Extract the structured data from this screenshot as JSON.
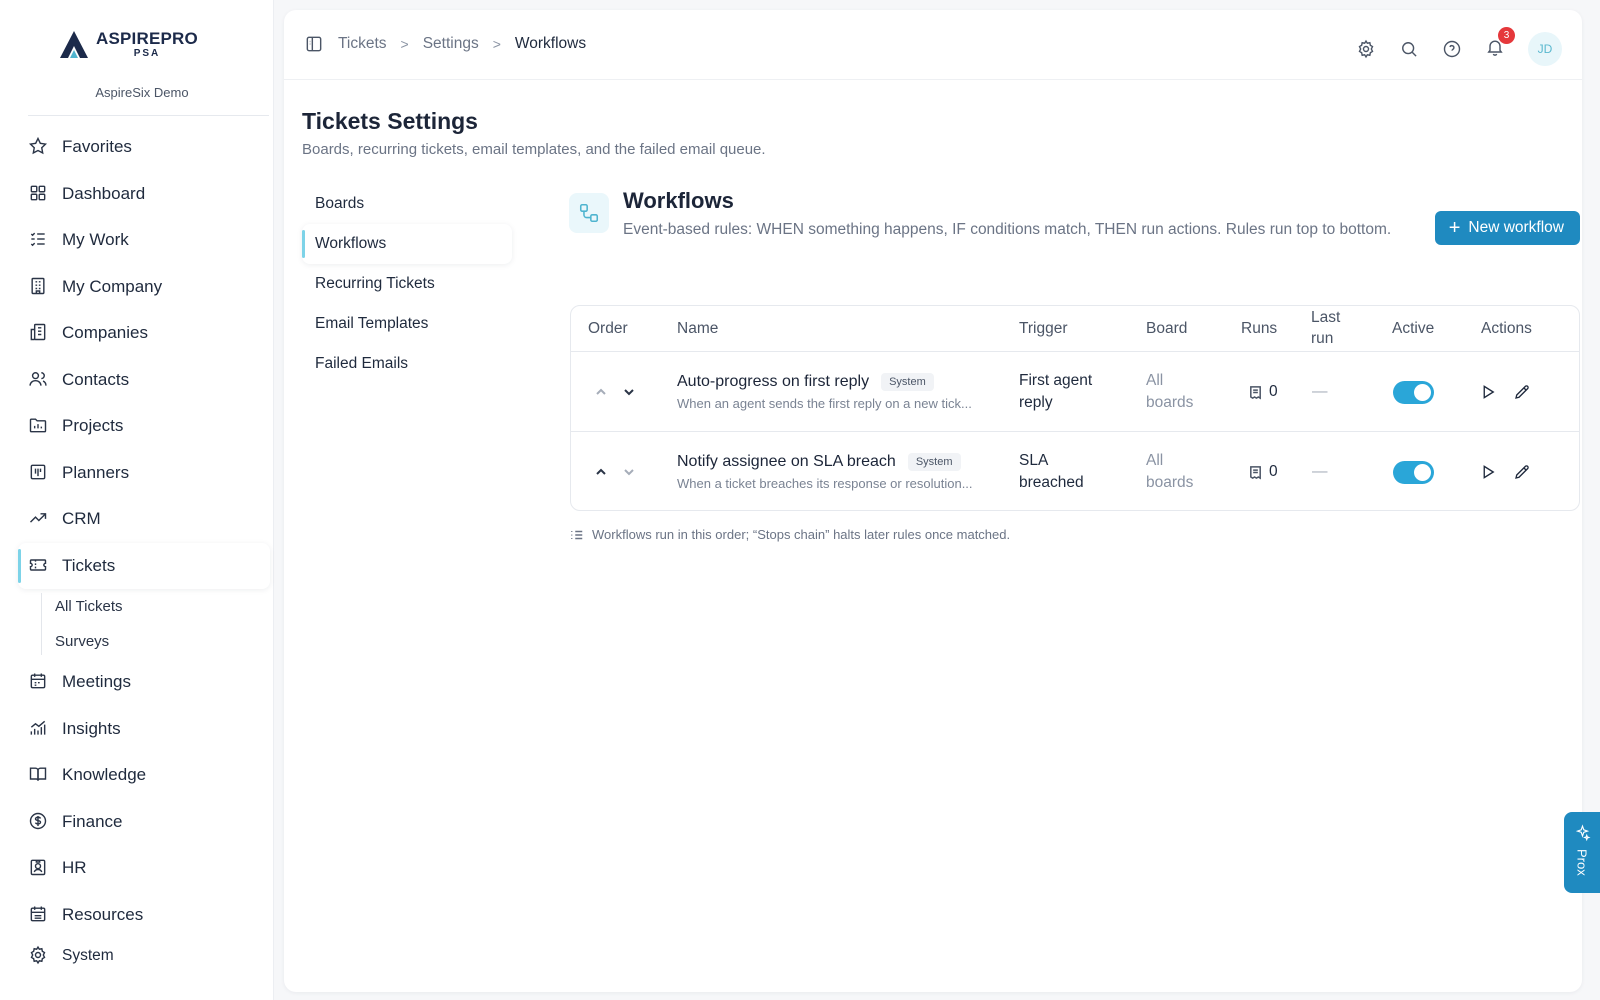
{
  "brand": {
    "name": "ASPIREPRO",
    "sub": "PSA",
    "org": "AspireSix Demo"
  },
  "sidebar": {
    "items": [
      {
        "label": "Favorites",
        "icon": "star-icon"
      },
      {
        "label": "Dashboard",
        "icon": "grid-icon"
      },
      {
        "label": "My Work",
        "icon": "list-check-icon"
      },
      {
        "label": "My Company",
        "icon": "building-icon"
      },
      {
        "label": "Companies",
        "icon": "buildings-icon"
      },
      {
        "label": "Contacts",
        "icon": "users-icon"
      },
      {
        "label": "Projects",
        "icon": "folder-chart-icon"
      },
      {
        "label": "Planners",
        "icon": "kanban-icon"
      },
      {
        "label": "CRM",
        "icon": "trending-up-icon"
      },
      {
        "label": "Tickets",
        "icon": "ticket-icon",
        "active": true
      },
      {
        "label": "Meetings",
        "icon": "calendar-icon"
      },
      {
        "label": "Insights",
        "icon": "bar-chart-icon"
      },
      {
        "label": "Knowledge",
        "icon": "book-icon"
      },
      {
        "label": "Finance",
        "icon": "dollar-circle-icon"
      },
      {
        "label": "HR",
        "icon": "id-badge-icon"
      },
      {
        "label": "Resources",
        "icon": "calendar-list-icon"
      },
      {
        "label": "System",
        "icon": "gear-icon"
      }
    ],
    "tickets_sub": [
      "All Tickets",
      "Surveys"
    ]
  },
  "breadcrumb": [
    "Tickets",
    "Settings",
    "Workflows"
  ],
  "notifications_count": "3",
  "avatar_initials": "JD",
  "page": {
    "title": "Tickets Settings",
    "subtitle": "Boards, recurring tickets, email templates, and the failed email queue."
  },
  "settings_nav": [
    "Boards",
    "Workflows",
    "Recurring Tickets",
    "Email Templates",
    "Failed Emails"
  ],
  "workflows": {
    "title": "Workflows",
    "description": "Event-based rules: WHEN something happens, IF conditions match, THEN run actions. Rules run top to bottom.",
    "new_button": "New workflow",
    "columns": {
      "order": "Order",
      "name": "Name",
      "trigger": "Trigger",
      "board": "Board",
      "runs": "Runs",
      "last_run_1": "Last",
      "last_run_2": "run",
      "active": "Active",
      "actions": "Actions"
    },
    "rows": [
      {
        "name": "Auto-progress on first reply",
        "badge": "System",
        "description": "When an agent sends the first reply on a new tick...",
        "trigger_1": "First agent",
        "trigger_2": "reply",
        "board_1": "All",
        "board_2": "boards",
        "runs": "0",
        "last_run": "—",
        "active": true
      },
      {
        "name": "Notify assignee on SLA breach",
        "badge": "System",
        "description": "When a ticket breaches its response or resolution...",
        "trigger_1": "SLA",
        "trigger_2": "breached",
        "board_1": "All",
        "board_2": "boards",
        "runs": "0",
        "last_run": "—",
        "active": true
      }
    ],
    "footnote": "Workflows run in this order; “Stops chain” halts later rules once matched."
  },
  "assistant": {
    "label": "Prox"
  },
  "colors": {
    "accent": "#1f8ac0",
    "toggle_on": "#2aa6d8",
    "active_marker": "#7dd3e8",
    "badge_red": "#e5383b"
  }
}
